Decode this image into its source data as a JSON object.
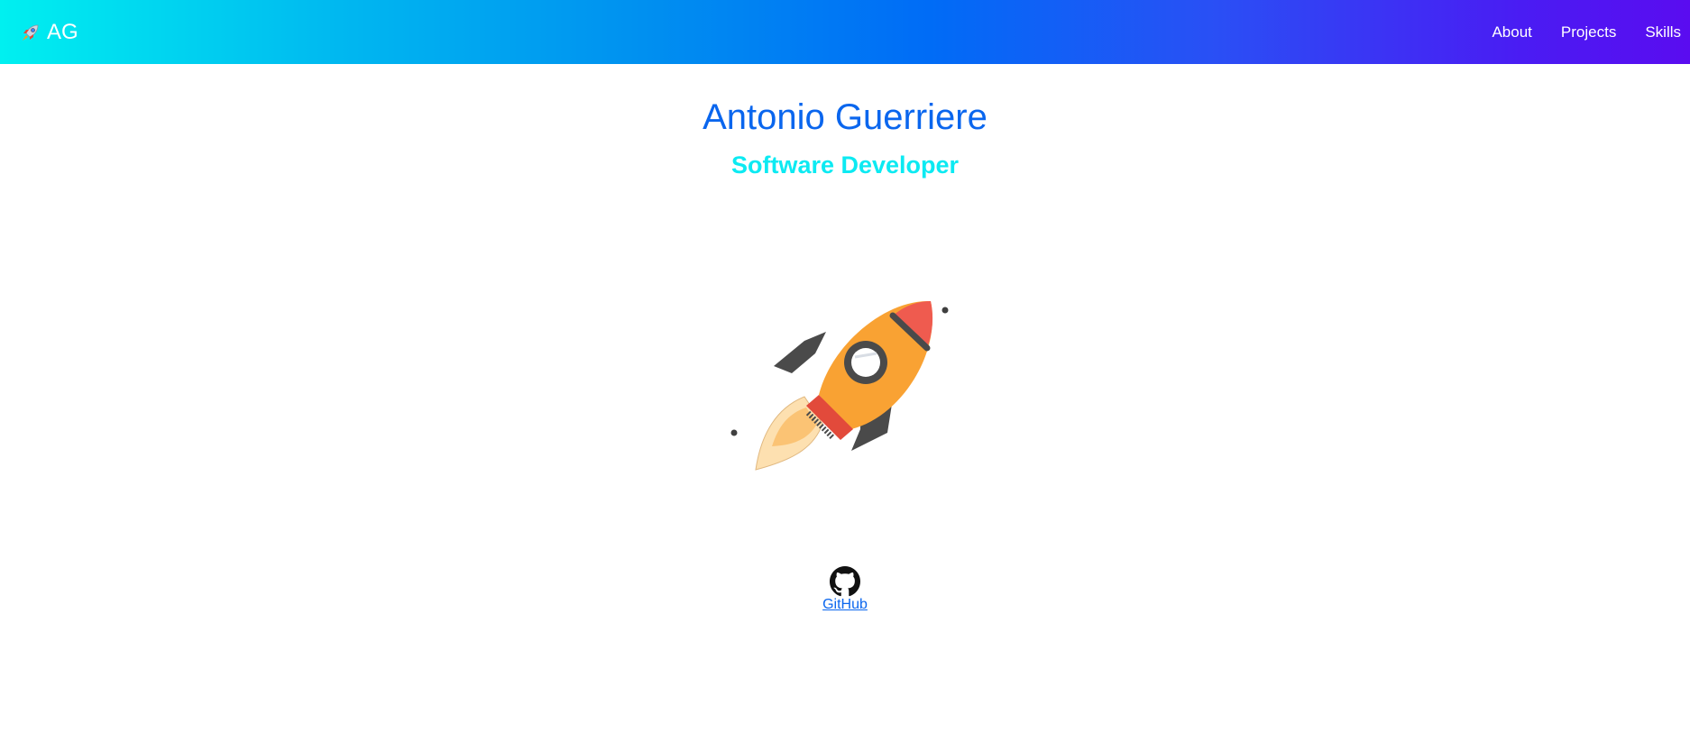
{
  "navbar": {
    "brand_label": "AG",
    "brand_icon": "rocket-emoji-icon",
    "links": [
      {
        "label": "About"
      },
      {
        "label": "Projects"
      },
      {
        "label": "Skills"
      }
    ],
    "gradient_colors": [
      "#00f0f0",
      "#006cf6",
      "#5a0cf0"
    ]
  },
  "hero": {
    "name": "Antonio Guerriere",
    "role": "Software Developer",
    "name_color": "#0a66ee",
    "role_color": "#0ceaf2"
  },
  "illustration": {
    "icon": "rocket-illustration"
  },
  "social": {
    "github_label": "GitHub",
    "github_icon": "github-icon"
  }
}
